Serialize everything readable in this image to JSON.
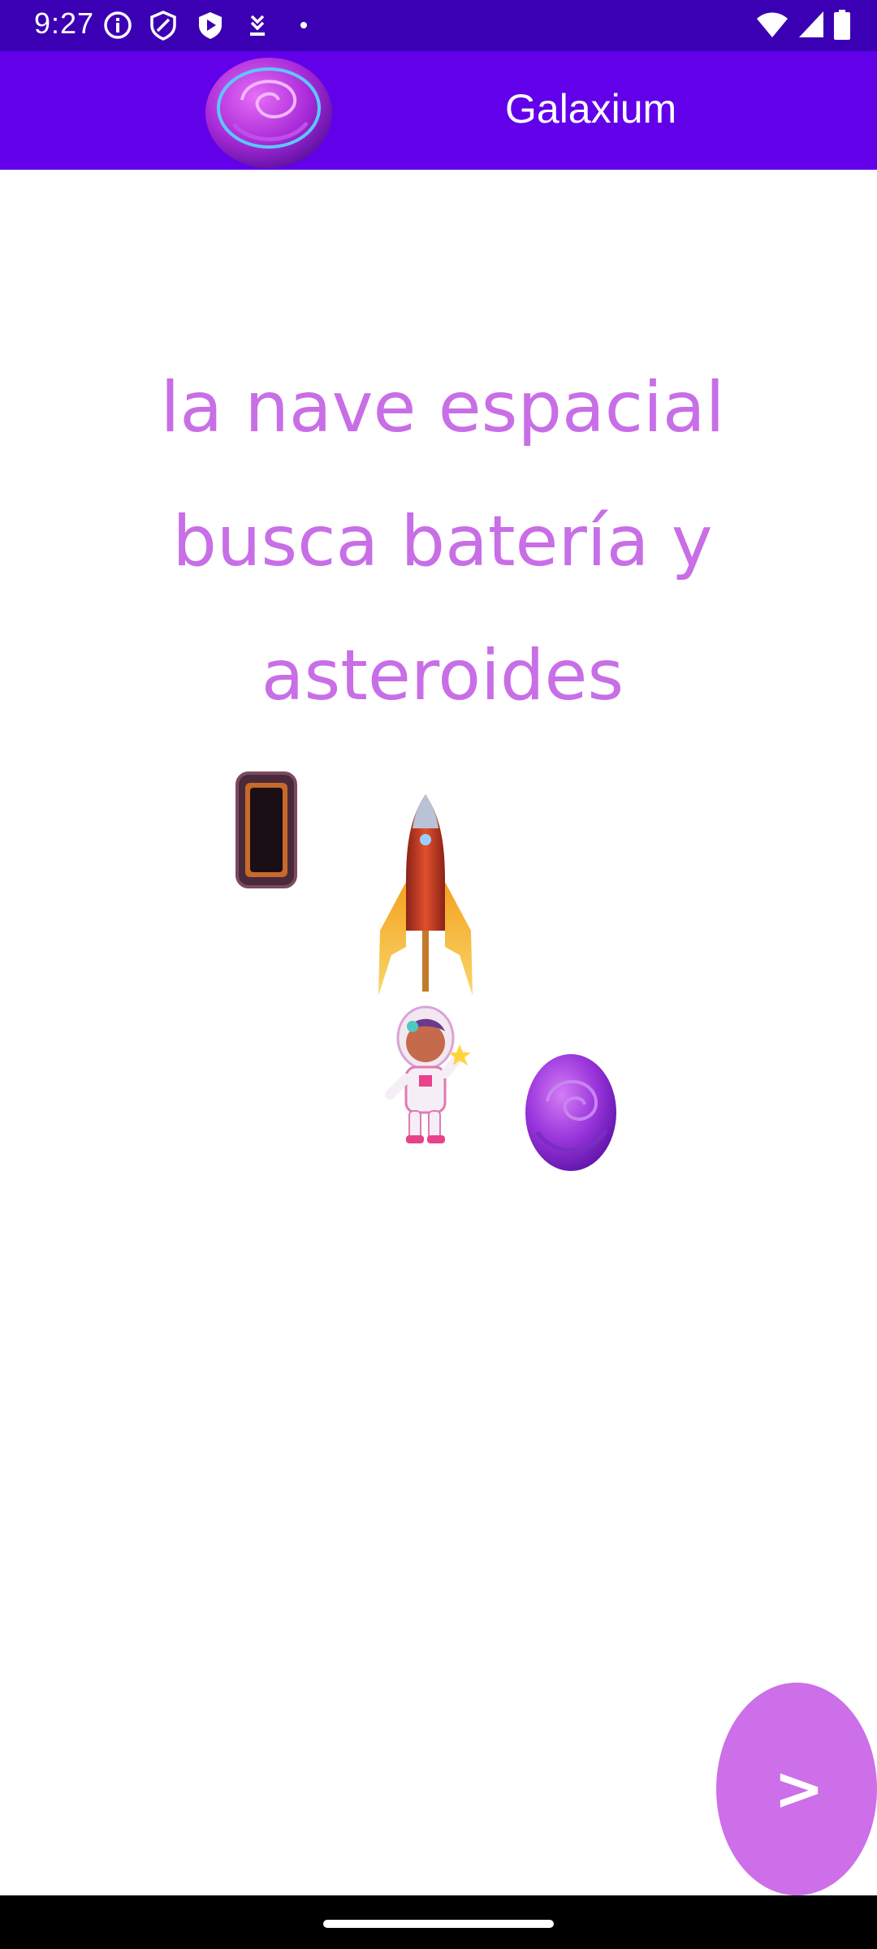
{
  "status_bar": {
    "time": "9:27",
    "left_icons": [
      "info-icon",
      "shield-icon",
      "play-protect-icon",
      "download-icon",
      "dot-icon"
    ],
    "right_icons": [
      "wifi-icon",
      "signal-icon",
      "battery-icon"
    ]
  },
  "app_bar": {
    "title": "Galaxium",
    "logo_icon": "purple-planet-logo-icon"
  },
  "content": {
    "caption_lines": [
      "la nave espacial",
      "busca batería y",
      "asteroides"
    ],
    "images": [
      "battery-icon",
      "rocket-icon",
      "astronaut-icon",
      "purple-planet-icon"
    ]
  },
  "next_button": {
    "label": ">"
  },
  "colors": {
    "status_bar": "#3c00b4",
    "app_bar": "#6200ea",
    "caption": "#c86ee6",
    "button": "#cc6fe8"
  }
}
